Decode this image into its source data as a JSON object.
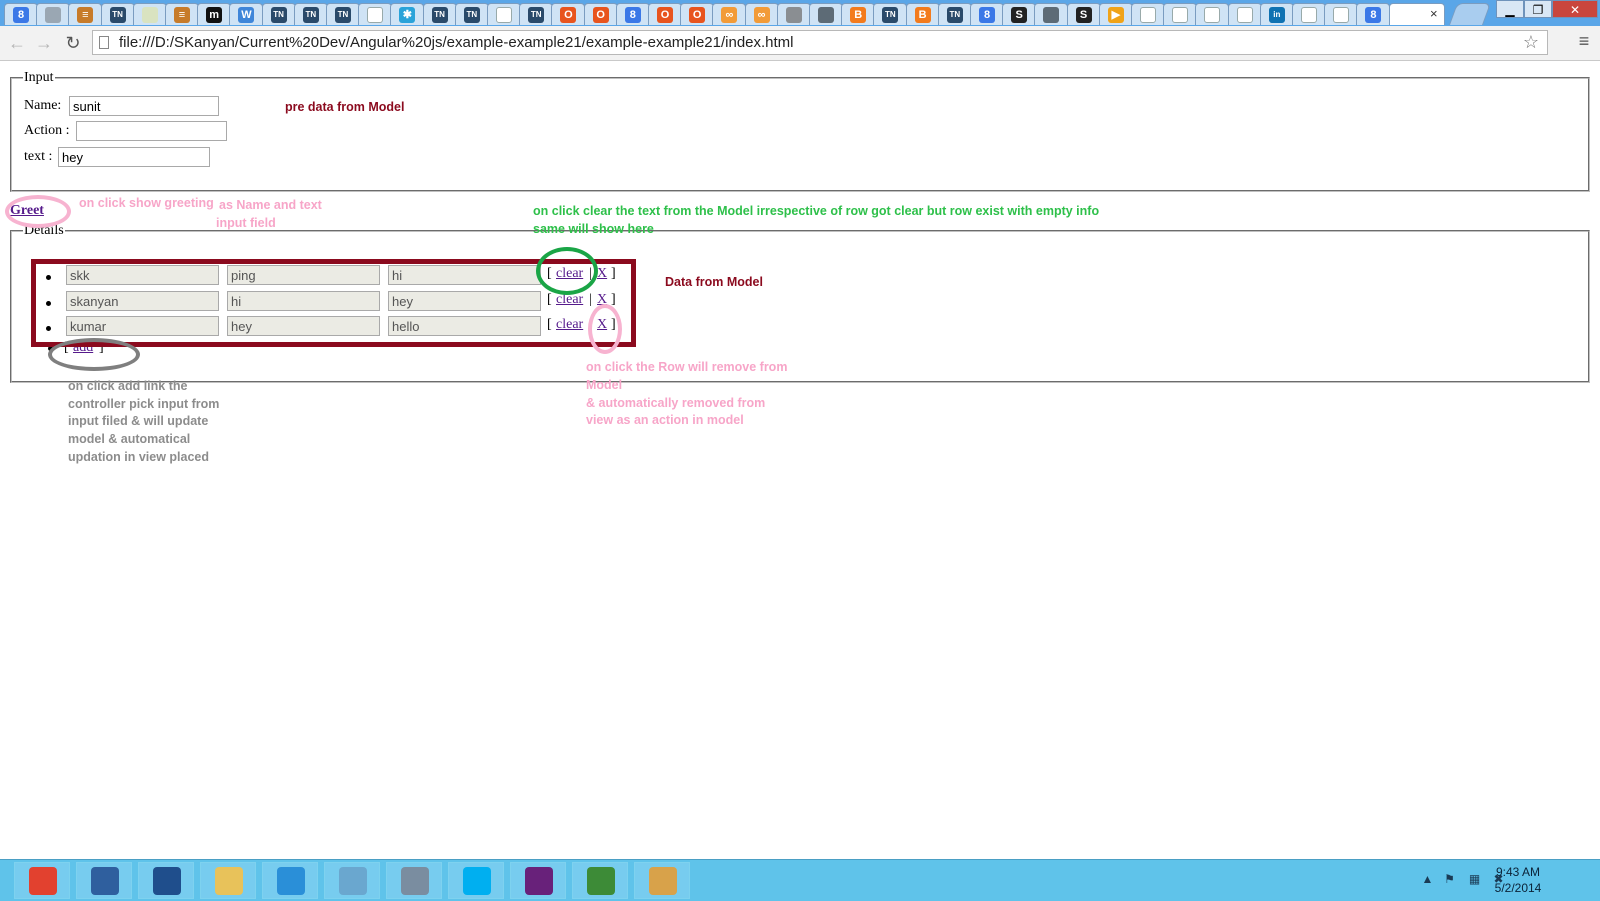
{
  "browser": {
    "tabs": [
      {
        "icon": "google-icon",
        "glyph": "8",
        "color": "#3b78e7"
      },
      {
        "icon": "gray-page-icon",
        "glyph": "",
        "color": "#9aa7b3"
      },
      {
        "icon": "stackoverflow-icon",
        "glyph": "≡",
        "color": "#c77b2a"
      },
      {
        "icon": "tn-icon",
        "glyph": "TN",
        "color": "#2a4a6a"
      },
      {
        "icon": "blank-icon",
        "glyph": "",
        "color": "#d9e3c0"
      },
      {
        "icon": "stackoverflow-icon",
        "glyph": "≡",
        "color": "#c77b2a"
      },
      {
        "icon": "m-icon",
        "glyph": "m",
        "color": "#111111"
      },
      {
        "icon": "w-icon",
        "glyph": "W",
        "color": "#3f86d9"
      },
      {
        "icon": "tn-icon",
        "glyph": "TN",
        "color": "#2a4a6a"
      },
      {
        "icon": "tn-italic-icon",
        "glyph": "TN",
        "color": "#2a4a6a"
      },
      {
        "icon": "tn-icon",
        "glyph": "TN",
        "color": "#2a4a6a"
      },
      {
        "icon": "page-icon",
        "glyph": "",
        "color": "#ffffff"
      },
      {
        "icon": "atlassian-icon",
        "glyph": "✱",
        "color": "#2aa3d9"
      },
      {
        "icon": "tn-italic-icon",
        "glyph": "TN",
        "color": "#2a4a6a"
      },
      {
        "icon": "tn-italic-icon",
        "glyph": "TN",
        "color": "#2a4a6a"
      },
      {
        "icon": "page-icon",
        "glyph": "",
        "color": "#ffffff"
      },
      {
        "icon": "tn-italic-icon",
        "glyph": "TN",
        "color": "#2a4a6a"
      },
      {
        "icon": "office-icon",
        "glyph": "O",
        "color": "#e8541e"
      },
      {
        "icon": "office-icon",
        "glyph": "O",
        "color": "#e8541e"
      },
      {
        "icon": "google-icon",
        "glyph": "8",
        "color": "#3b78e7"
      },
      {
        "icon": "office-icon",
        "glyph": "O",
        "color": "#e8541e"
      },
      {
        "icon": "office-icon",
        "glyph": "O",
        "color": "#e8541e"
      },
      {
        "icon": "rings-icon",
        "glyph": "∞",
        "color": "#f29b38"
      },
      {
        "icon": "rings-icon",
        "glyph": "∞",
        "color": "#f29b38"
      },
      {
        "icon": "avatar-icon",
        "glyph": "",
        "color": "#8a8e92"
      },
      {
        "icon": "photo-icon",
        "glyph": "",
        "color": "#5d6b76"
      },
      {
        "icon": "blogger-icon",
        "glyph": "B",
        "color": "#f37b1d"
      },
      {
        "icon": "tn-italic-icon",
        "glyph": "TN",
        "color": "#2a4a6a"
      },
      {
        "icon": "blogger-icon",
        "glyph": "B",
        "color": "#f37b1d"
      },
      {
        "icon": "tn-italic-icon",
        "glyph": "TN",
        "color": "#2a4a6a"
      },
      {
        "icon": "google-icon",
        "glyph": "8",
        "color": "#3b78e7"
      },
      {
        "icon": "s-icon",
        "glyph": "S",
        "color": "#222222"
      },
      {
        "icon": "photo-icon",
        "glyph": "",
        "color": "#5d6b76"
      },
      {
        "icon": "s-icon",
        "glyph": "S",
        "color": "#222222"
      },
      {
        "icon": "play-icon",
        "glyph": "▶",
        "color": "#f0a318"
      },
      {
        "icon": "page-icon",
        "glyph": "",
        "color": "#ffffff"
      },
      {
        "icon": "page-icon",
        "glyph": "",
        "color": "#ffffff"
      },
      {
        "icon": "page-icon",
        "glyph": "",
        "color": "#ffffff"
      },
      {
        "icon": "page-icon",
        "glyph": "",
        "color": "#ffffff"
      },
      {
        "icon": "linkedin-icon",
        "glyph": "in",
        "color": "#0f72b2"
      },
      {
        "icon": "page-icon",
        "glyph": "",
        "color": "#ffffff"
      },
      {
        "icon": "page-icon",
        "glyph": "",
        "color": "#ffffff"
      },
      {
        "icon": "google-icon",
        "glyph": "8",
        "color": "#3b78e7"
      }
    ],
    "active_tab_close": "×",
    "window_controls": {
      "minimize": "▁",
      "restore": "❐",
      "close": "✕"
    },
    "back": "←",
    "forward": "→",
    "reload": "↻",
    "url": "file:///D:/SKanyan/Current%20Dev/Angular%20js/example-example21/example-example21/index.html",
    "bookmark_star": "☆",
    "menu": "≡"
  },
  "page": {
    "input_legend": "Input",
    "name_label": "Name:",
    "name_value": "sunit",
    "action_label": "Action :",
    "action_value": "",
    "text_label": "text :",
    "text_value": "hey",
    "greet_link": "Greet",
    "details_legend": "Details",
    "rows": [
      {
        "name": "skk",
        "action": "ping",
        "text": "hi"
      },
      {
        "name": "skanyan",
        "action": "hi",
        "text": "hey"
      },
      {
        "name": "kumar",
        "action": "hey",
        "text": "hello"
      }
    ],
    "row_open_bracket": "[",
    "row_clear": "clear",
    "row_sep": "|",
    "row_remove": "X",
    "row_close_bracket": "]",
    "add_open_bracket": "[",
    "add_link": "add",
    "add_close_bracket": "]"
  },
  "annotations": {
    "pre_data": "pre data from Model",
    "greet_note_1": "on click show greeting",
    "greet_note_2": "as Name and text",
    "greet_note_3": "input field",
    "clear_note_1": "on click clear the text from the Model irrespective of row got clear but row exist with empty info",
    "clear_note_2": "same will show here",
    "data_from_model": "Data from Model",
    "remove_note_1": "on click the Row will remove from",
    "remove_note_2": "Model",
    "remove_note_3": "& automatically removed from",
    "remove_note_4": "view as an action in model",
    "add_note_1": "on click add link the",
    "add_note_2": "controller pick input from",
    "add_note_3": "input filed & will update",
    "add_note_4": "model & automatical",
    "add_note_5": "updation in  view placed"
  },
  "taskbar": {
    "apps": [
      {
        "icon": "chrome-icon",
        "color": "#e2412f"
      },
      {
        "icon": "server-manager-icon",
        "color": "#2f5f9e"
      },
      {
        "icon": "powershell-icon",
        "color": "#1f4e8c"
      },
      {
        "icon": "file-explorer-icon",
        "color": "#e8c25a"
      },
      {
        "icon": "internet-explorer-icon",
        "color": "#2a8fd8"
      },
      {
        "icon": "notepad-tablet-icon",
        "color": "#6aa7cf"
      },
      {
        "icon": "tools-icon",
        "color": "#7a8da0"
      },
      {
        "icon": "skype-icon",
        "color": "#00aff0"
      },
      {
        "icon": "visual-studio-icon",
        "color": "#68217a"
      },
      {
        "icon": "chart-app-icon",
        "color": "#3d8b37"
      },
      {
        "icon": "paint-icon",
        "color": "#d8a24a"
      }
    ],
    "tray": [
      {
        "icon": "show-hidden-icons-icon",
        "glyph": "▲"
      },
      {
        "icon": "action-center-icon",
        "glyph": "⚑"
      },
      {
        "icon": "network-icon",
        "glyph": "▦"
      },
      {
        "icon": "volume-muted-icon",
        "glyph": "✖"
      }
    ],
    "time": "9:43 AM",
    "date": "5/2/2014"
  }
}
